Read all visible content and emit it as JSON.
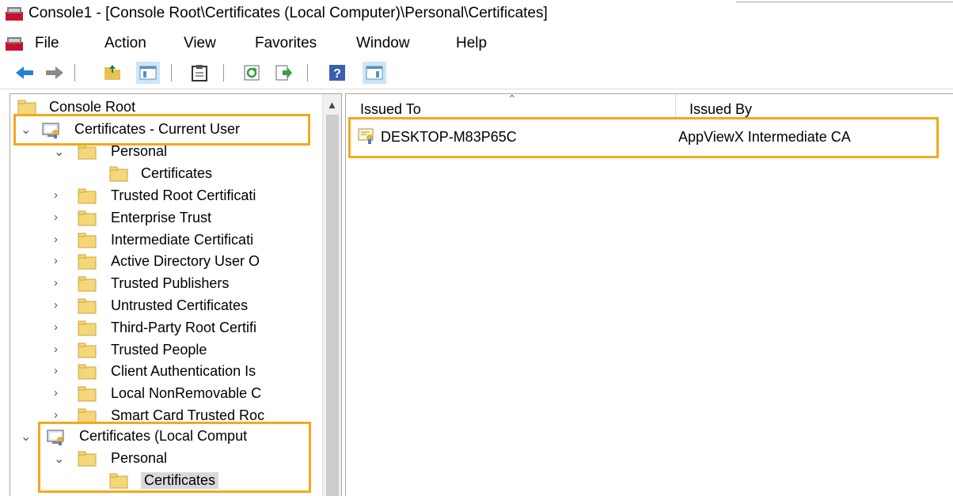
{
  "window": {
    "title": "Console1 - [Console Root\\Certificates (Local Computer)\\Personal\\Certificates]"
  },
  "menu": [
    "File",
    "Action",
    "View",
    "Favorites",
    "Window",
    "Help"
  ],
  "toolbar": {
    "icons": [
      "back-arrow-icon",
      "forward-arrow-icon",
      "up-folder-icon",
      "show-hide-console-tree-icon",
      "export-list-icon",
      "refresh-icon",
      "export-icon",
      "help-icon",
      "show-hide-action-pane-icon"
    ]
  },
  "tree": {
    "root": "Console Root",
    "current_user": {
      "label": "Certificates - Current User",
      "personal": "Personal",
      "certificates": "Certificates",
      "stores": [
        "Trusted Root Certificati",
        "Enterprise Trust",
        "Intermediate Certificati",
        "Active Directory User O",
        "Trusted Publishers",
        "Untrusted Certificates",
        "Third-Party Root Certifi",
        "Trusted People",
        "Client Authentication Is",
        "Local NonRemovable C",
        "Smart Card Trusted Roc"
      ]
    },
    "local_computer": {
      "label": "Certificates (Local Comput",
      "personal": "Personal",
      "certificates": "Certificates"
    }
  },
  "list": {
    "columns": [
      "Issued To",
      "Issued By"
    ],
    "rows": [
      {
        "issued_to": "DESKTOP-M83P65C",
        "issued_by": "AppViewX Intermediate CA"
      }
    ]
  },
  "colors": {
    "highlight": "#f4a81d",
    "selected": "#d9d9d9"
  }
}
